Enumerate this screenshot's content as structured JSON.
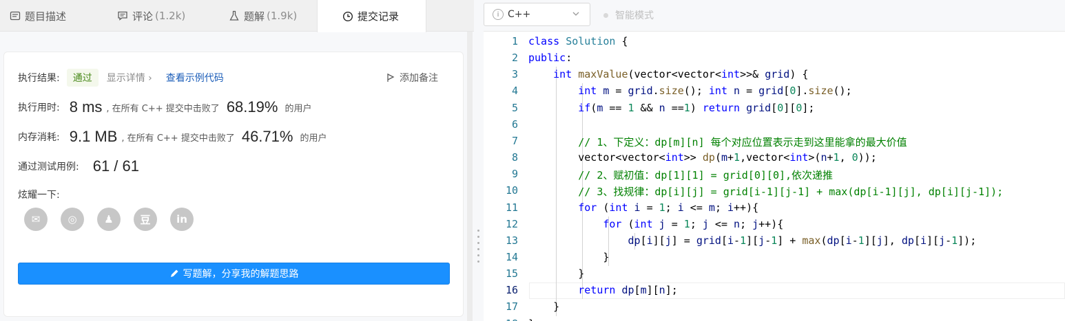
{
  "tabs": [
    {
      "label": "题目描述",
      "count": ""
    },
    {
      "label": "评论",
      "count": "(1.2k)"
    },
    {
      "label": "题解",
      "count": "(1.9k)"
    },
    {
      "label": "提交记录",
      "count": ""
    }
  ],
  "result": {
    "label": "执行结果:",
    "status": "通过",
    "detail": "显示详情 ›",
    "example_link": "查看示例代码",
    "add_note": "添加备注"
  },
  "runtime": {
    "label": "执行用时:",
    "value": "8 ms",
    "prefix": ", 在所有 C++ 提交中击败了",
    "percent": "68.19%",
    "suffix": "的用户"
  },
  "memory": {
    "label": "内存消耗:",
    "value": "9.1 MB",
    "prefix": ", 在所有 C++ 提交中击败了",
    "percent": "46.71%",
    "suffix": "的用户"
  },
  "tests": {
    "label": "通过测试用例:",
    "value": "61 / 61"
  },
  "share": {
    "label": "炫耀一下:",
    "icons": [
      "wechat-icon",
      "weibo-icon",
      "qq-icon",
      "douban-icon",
      "linkedin-icon"
    ],
    "glyphs": [
      "✉",
      "◎",
      "♟",
      "豆",
      "in"
    ]
  },
  "write_button": "写题解，分享我的解题思路",
  "editor": {
    "language": "C++",
    "smart_mode": "智能模式",
    "current_line": 16,
    "lines": [
      "class Solution {",
      "public:",
      "    int maxValue(vector<vector<int>>& grid) {",
      "        int m = grid.size(); int n = grid[0].size();",
      "        if(m == 1 && n ==1) return grid[0][0];",
      "",
      "        // 1、下定义：dp[m][n] 每个对应位置表示走到这里能拿的最大价值",
      "        vector<vector<int>> dp(m+1,vector<int>(n+1, 0));",
      "        // 2、赋初值：dp[1][1] = grid[0][0],依次递推",
      "        // 3、找规律：dp[i][j] = grid[i-1][j-1] + max(dp[i-1][j], dp[i][j-1]);",
      "        for (int i = 1; i <= m; i++){",
      "            for (int j = 1; j <= n; j++){",
      "                dp[i][j] = grid[i-1][j-1] + max(dp[i-1][j], dp[i][j-1]);",
      "            }",
      "        }",
      "        return dp[m][n];",
      "    }",
      "};"
    ]
  }
}
